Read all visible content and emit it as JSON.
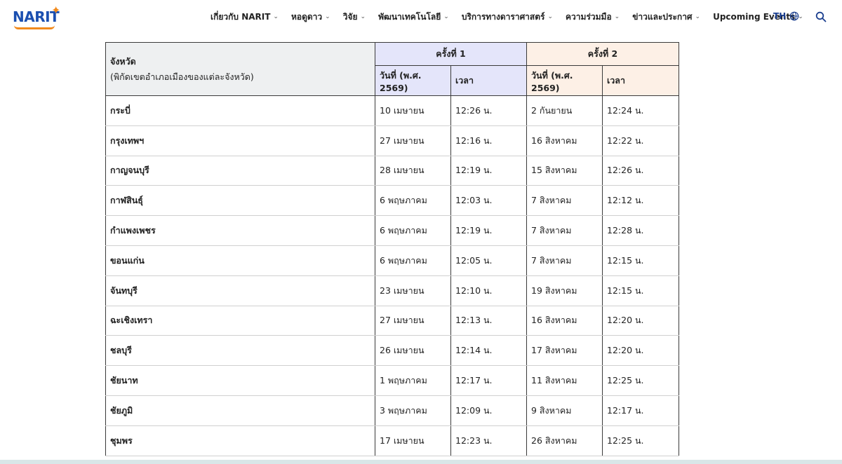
{
  "logo": {
    "text": "NARIT",
    "accent": "#f28a1c",
    "brand": "#1b4fb0"
  },
  "nav": {
    "items": [
      {
        "label": "เกี่ยวกับ NARIT",
        "dropdown": true
      },
      {
        "label": "หอดูดาว",
        "dropdown": true
      },
      {
        "label": "วิจัย",
        "dropdown": true
      },
      {
        "label": "พัฒนาเทคโนโลยี",
        "dropdown": true
      },
      {
        "label": "บริการทางดาราศาสตร์",
        "dropdown": true
      },
      {
        "label": "ความร่วมมือ",
        "dropdown": true
      },
      {
        "label": "ข่าวและประกาศ",
        "dropdown": true
      },
      {
        "label": "Upcoming Events",
        "dropdown": true
      }
    ],
    "language": "TH",
    "language_icon": "globe-icon",
    "search_icon": "search-icon"
  },
  "table": {
    "province_header": "จังหวัด",
    "province_subheader": "(พิกัดเขตอำเภอเมืองของแต่ละจังหวัด)",
    "round1": "ครั้งที่ 1",
    "round2": "ครั้งที่ 2",
    "date_header": "วันที่ (พ.ศ. 2569)",
    "time_header": "เวลา",
    "colors": {
      "round1_bg": "#e4e5fa",
      "round2_bg": "#fdf0e6",
      "province_bg": "#eef0f1"
    },
    "rows": [
      {
        "province": "กระบี่",
        "d1": "10 เมษายน",
        "t1": "12:26 น.",
        "d2": "2 กันยายน",
        "t2": "12:24 น."
      },
      {
        "province": "กรุงเทพฯ",
        "d1": "27 เมษายน",
        "t1": "12:16 น.",
        "d2": "16 สิงหาคม",
        "t2": "12:22 น."
      },
      {
        "province": "กาญจนบุรี",
        "d1": "28 เมษายน",
        "t1": "12:19 น.",
        "d2": "15 สิงหาคม",
        "t2": "12:26 น."
      },
      {
        "province": "กาฬสินธุ์",
        "d1": "6 พฤษภาคม",
        "t1": "12:03 น.",
        "d2": "7 สิงหาคม",
        "t2": "12:12 น."
      },
      {
        "province": "กำแพงเพชร",
        "d1": "6 พฤษภาคม",
        "t1": "12:19 น.",
        "d2": "7 สิงหาคม",
        "t2": "12:28 น."
      },
      {
        "province": "ขอนแก่น",
        "d1": "6 พฤษภาคม",
        "t1": "12:05 น.",
        "d2": "7 สิงหาคม",
        "t2": "12:15 น."
      },
      {
        "province": "จันทบุรี",
        "d1": "23 เมษายน",
        "t1": "12:10 น.",
        "d2": "19 สิงหาคม",
        "t2": "12:15 น."
      },
      {
        "province": "ฉะเชิงเทรา",
        "d1": "27 เมษายน",
        "t1": "12:13 น.",
        "d2": "16 สิงหาคม",
        "t2": "12:20 น."
      },
      {
        "province": "ชลบุรี",
        "d1": "26 เมษายน",
        "t1": "12:14 น.",
        "d2": "17 สิงหาคม",
        "t2": "12:20 น."
      },
      {
        "province": "ชัยนาท",
        "d1": "1 พฤษภาคม",
        "t1": "12:17 น.",
        "d2": "11 สิงหาคม",
        "t2": "12:25 น."
      },
      {
        "province": "ชัยภูมิ",
        "d1": "3 พฤษภาคม",
        "t1": "12:09 น.",
        "d2": "9 สิงหาคม",
        "t2": "12:17 น."
      },
      {
        "province": "ชุมพร",
        "d1": "17 เมษายน",
        "t1": "12:23 น.",
        "d2": "26 สิงหาคม",
        "t2": "12:25 น."
      }
    ]
  }
}
